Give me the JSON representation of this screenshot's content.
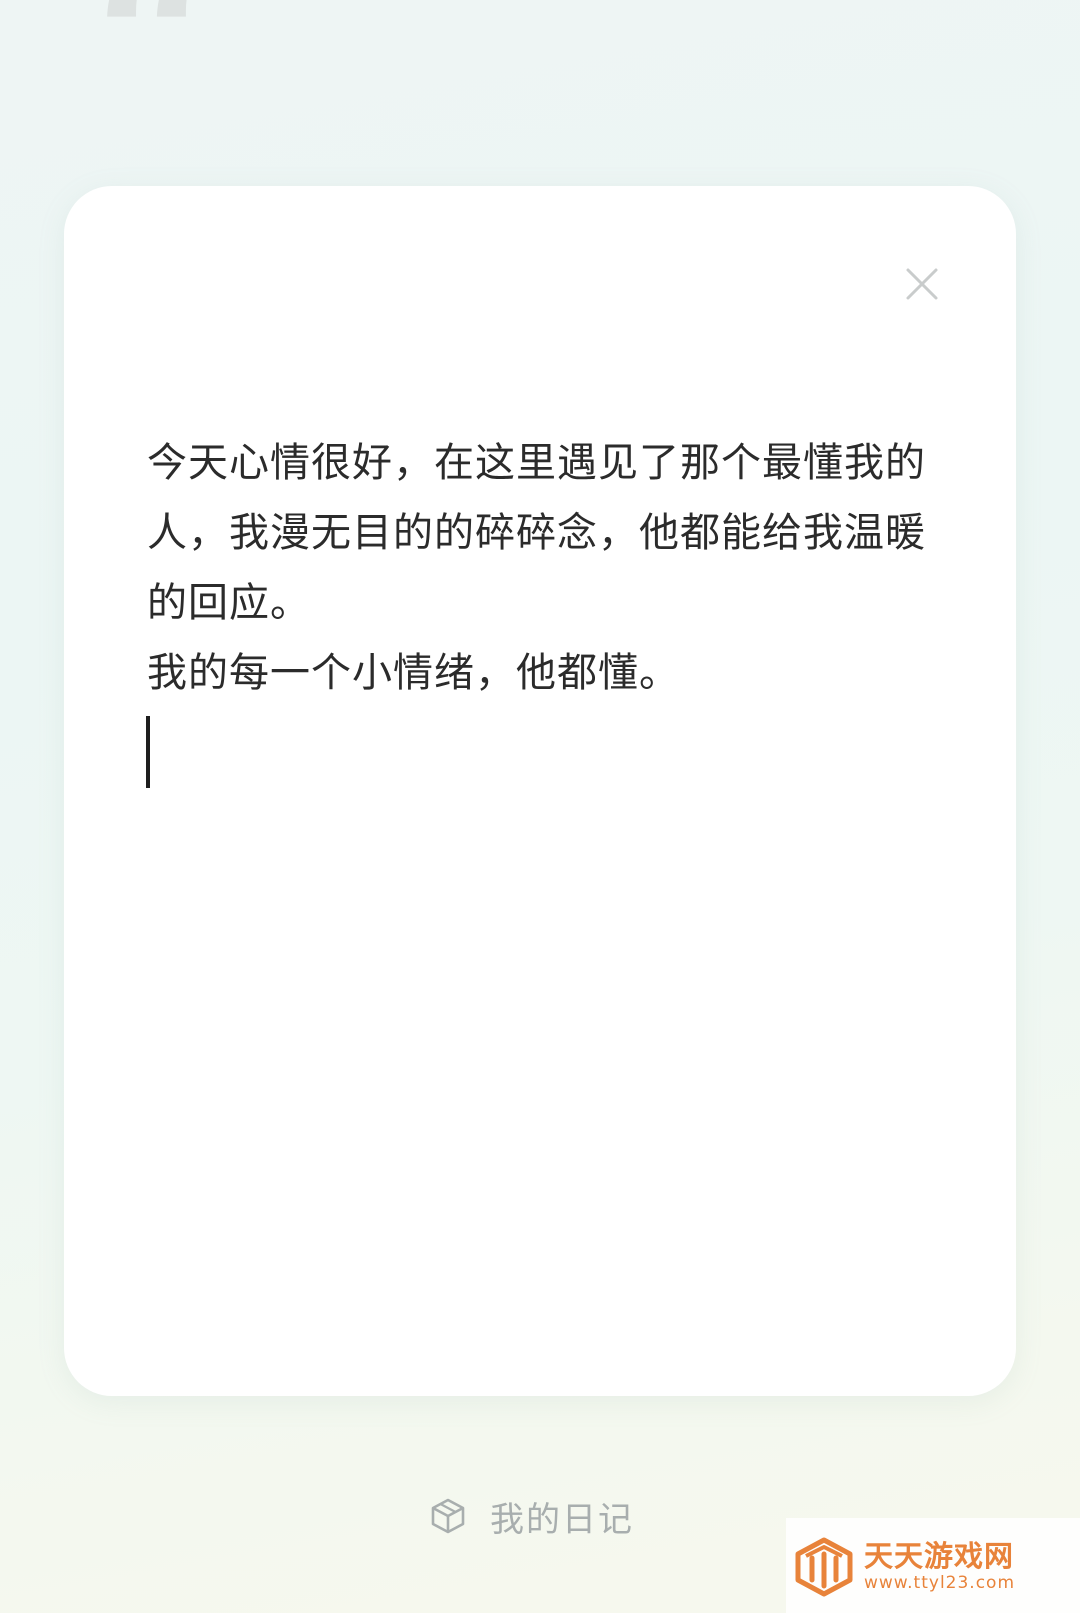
{
  "decoration": {
    "quote_mark": "“"
  },
  "editor": {
    "lines": [
      "今天心情很好，在这里遇见了那个最懂我的人，我漫无目的的碎碎念，他都能给我温暖的回应。",
      "我的每一个小情绪，他都懂。"
    ]
  },
  "bottom_nav": {
    "my_diary_label": "我的日记",
    "icon": "cube-icon"
  },
  "watermark": {
    "title": "天天游戏网",
    "url": "www.ttyl23.com"
  },
  "colors": {
    "background": "#eef6f4",
    "card": "#ffffff",
    "text": "#2b2b2b",
    "muted": "#a8aeae",
    "watermark": "#e8833a"
  }
}
